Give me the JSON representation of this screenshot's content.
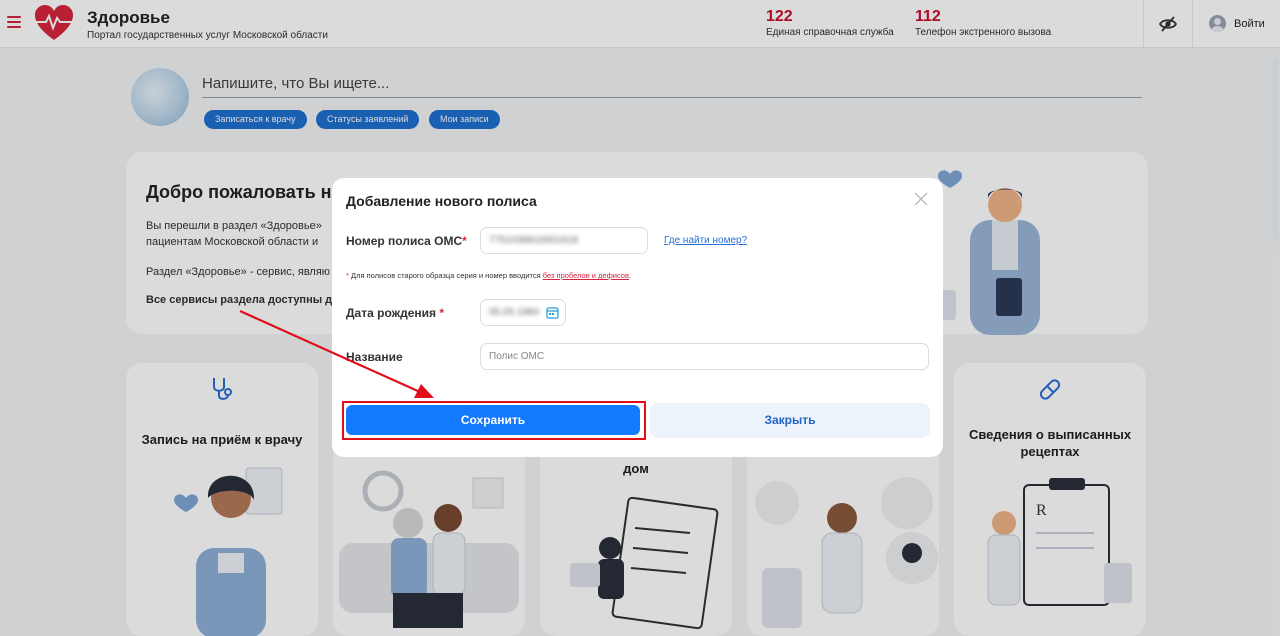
{
  "header": {
    "title": "Здоровье",
    "subtitle": "Портал государственных услуг Московской области",
    "phones": [
      {
        "number": "122",
        "label": "Единая справочная служба"
      },
      {
        "number": "112",
        "label": "Телефон экстренного вызова"
      }
    ],
    "login_label": "Войти",
    "icons": {
      "menu": "hamburger-icon",
      "logo": "heart-pulse-icon",
      "accessibility": "eye-off-icon",
      "user": "user-avatar-icon"
    }
  },
  "search": {
    "placeholder": "Напишите, что Вы ищете...",
    "quick_links": [
      "Записаться к врачу",
      "Статусы заявлений",
      "Мои записи"
    ]
  },
  "welcome": {
    "heading": "Добро пожаловать на",
    "para1_line1": "Вы перешли в раздел «Здоровье» ",
    "para1_line2": "пациентам Московской области и",
    "para2": "Раздел «Здоровье» - сервис, являю",
    "para3": "Все сервисы раздела доступны дл"
  },
  "cards": [
    {
      "title": "Запись на приём к врачу",
      "icon": "stethoscope-icon"
    },
    {
      "title": "",
      "icon": ""
    },
    {
      "title": "дом",
      "icon": ""
    },
    {
      "title": "",
      "icon": ""
    },
    {
      "title": "Сведения о выписанных рецептах",
      "icon": "pill-icon"
    }
  ],
  "modal": {
    "title": "Добавление нового полиса",
    "policy_label": "Номер полиса ОМС",
    "policy_required_mark": "*",
    "policy_value": "7751038810001618",
    "help_link": "Где найти номер?",
    "note_mark": "* ",
    "note_text": "Для полисов старого образца серия и номер вводится ",
    "note_link": "без пробелов и дефисов",
    "note_end": ".",
    "dob_label": "Дата рождения",
    "dob_required_mark": " *",
    "dob_value": "05.05.1984",
    "name_label": "Название",
    "name_placeholder": "Полис ОМС",
    "save_label": "Сохранить",
    "close_label": "Закрыть",
    "icons": {
      "close": "close-icon",
      "calendar": "calendar-icon"
    }
  },
  "colors": {
    "brand_red": "#c8102e",
    "primary_blue": "#1379ff",
    "highlight_red": "#e10e1a"
  }
}
